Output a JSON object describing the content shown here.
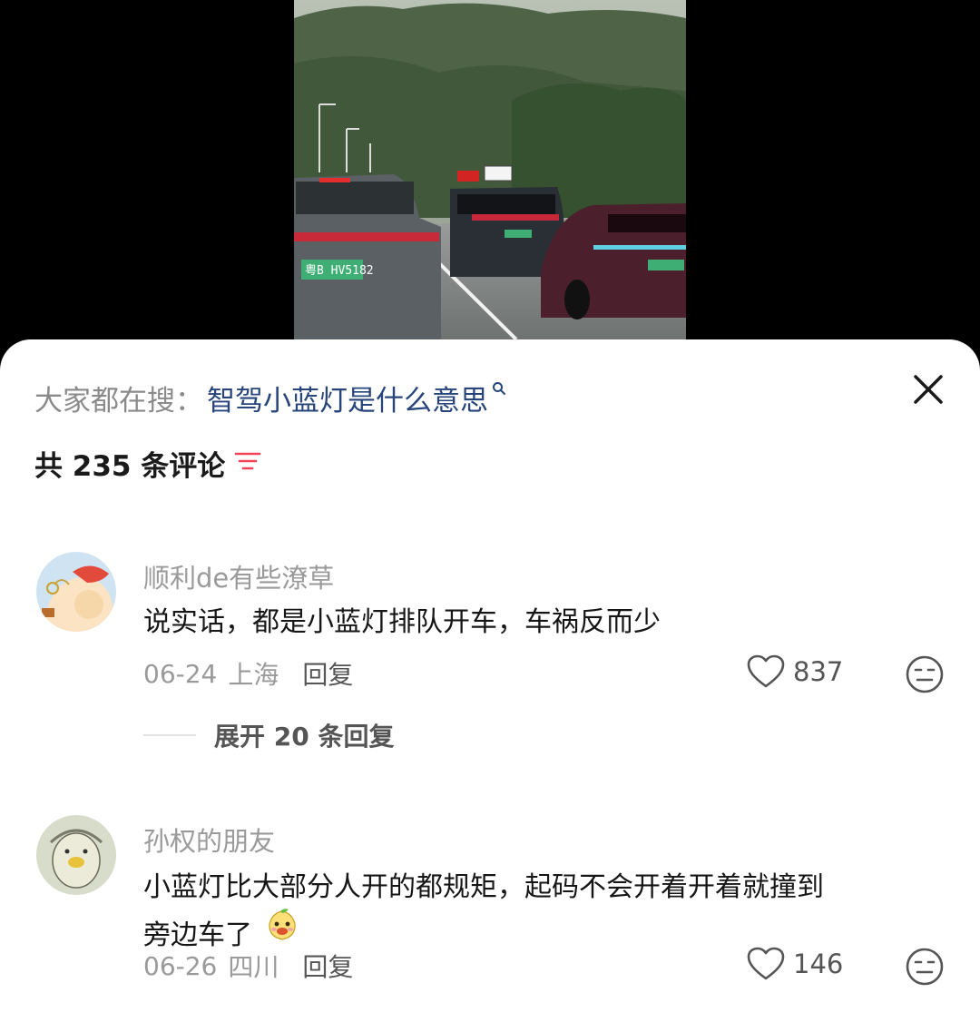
{
  "search": {
    "prefix": "大家都在搜：",
    "term": "智驾小蓝灯是什么意思"
  },
  "comments_header": {
    "count_text": "共 235 条评论"
  },
  "icons": {
    "close": "close-icon",
    "sort": "sort-icon",
    "like": "heart-icon",
    "dislike": "meh-face-icon",
    "search": "search-icon"
  },
  "colors": {
    "search_term": "#27457a",
    "sort_accent": "#f0435a",
    "sheet_bg": "#ffffff"
  },
  "comments": [
    {
      "username": "顺利de有些潦草",
      "text": "说实话，都是小蓝灯排队开车，车祸反而少",
      "date": "06-24",
      "location": "上海",
      "reply_label": "回复",
      "likes": "837",
      "expand_label": "展开 20 条回复"
    },
    {
      "username": "孙权的朋友",
      "text_line1": "小蓝灯比大部分人开的都规矩，起码不会开着开着就撞到",
      "text_line2": "旁边车了",
      "date": "06-26",
      "location": "四川",
      "reply_label": "回复",
      "likes": "146"
    }
  ]
}
